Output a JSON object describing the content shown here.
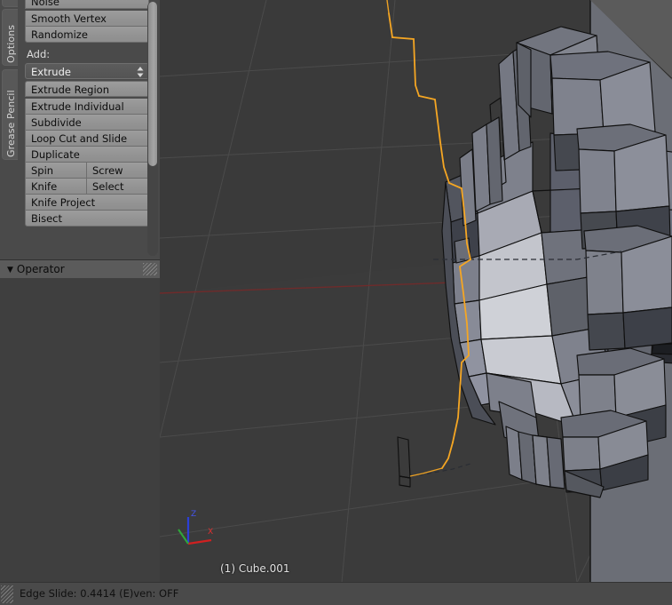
{
  "app": {
    "name": "Blender",
    "theme_bg": "#3d3d3d"
  },
  "tabs": [
    {
      "label": "",
      "name": "tab-partial"
    },
    {
      "label": "Options",
      "name": "tab-options"
    },
    {
      "label": "Grease Pencil",
      "name": "tab-grease-pencil"
    }
  ],
  "tool_panel": {
    "top_buttons": [
      {
        "label": "Noise"
      },
      {
        "label": "Smooth Vertex"
      },
      {
        "label": "Randomize"
      }
    ],
    "add_label": "Add:",
    "dropdown": {
      "value": "Extrude",
      "arrows": "▲▼"
    },
    "add_buttons": [
      {
        "label": "Extrude Region"
      },
      {
        "label": "Extrude Individual"
      },
      {
        "label": "Subdivide"
      },
      {
        "label": "Loop Cut and Slide"
      },
      {
        "label": "Duplicate"
      }
    ],
    "split_rows": [
      {
        "left": "Spin",
        "right": "Screw"
      },
      {
        "left": "Knife",
        "right": "Select"
      }
    ],
    "bottom_buttons": [
      {
        "label": "Knife Project"
      },
      {
        "label": "Bisect"
      }
    ]
  },
  "operator": {
    "title": "Operator",
    "triangle": "▼"
  },
  "viewport": {
    "object_label": "(1) Cube.001",
    "axis": {
      "z": "Z",
      "x": "X",
      "y": ""
    },
    "colors": {
      "background_top": "#3a3a3a",
      "background_floor": "#393939",
      "grid_line": "#4b4b4b",
      "x_axis_line": "#6d2a2a",
      "selected_edge": "#f5a623",
      "wire": "#121212",
      "backdrop_plane": "#6e7079"
    }
  },
  "status_bar": {
    "text": "Edge Slide: 0.4414 (E)ven: OFF"
  }
}
